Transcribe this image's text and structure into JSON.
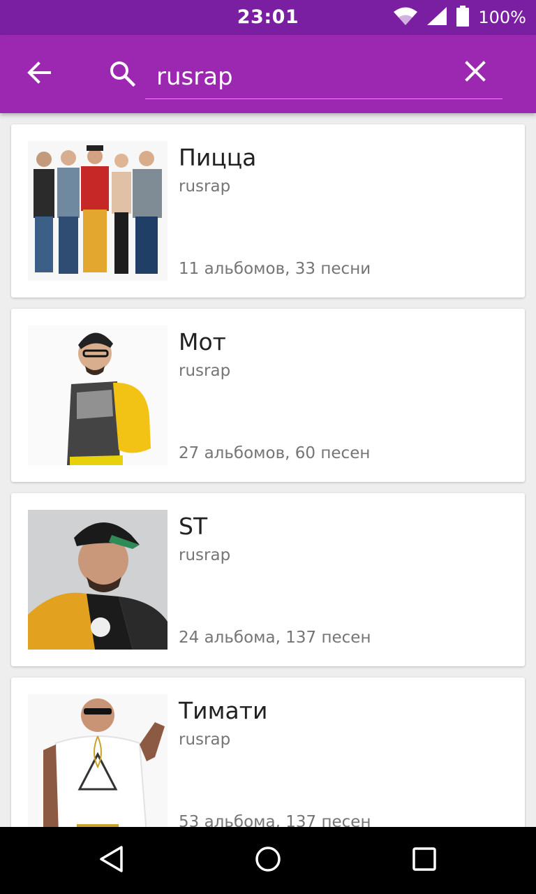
{
  "status_bar": {
    "time": "23:01",
    "battery_percent": "100%",
    "icons": [
      "wifi-icon",
      "signal-icon",
      "battery-icon"
    ]
  },
  "search": {
    "query": "rusrap",
    "icons": [
      "back-arrow-icon",
      "search-icon",
      "close-icon"
    ]
  },
  "colors": {
    "status_bar": "#7b1fa2",
    "app_bar": "#9c27b0",
    "background": "#eeeeee"
  },
  "results": [
    {
      "name": "Пицца",
      "genre": "rusrap",
      "counts": "11 альбомов, 33 песни"
    },
    {
      "name": "Мот",
      "genre": "rusrap",
      "counts": "27 альбомов, 60 песен"
    },
    {
      "name": "ST",
      "genre": "rusrap",
      "counts": "24 альбома, 137 песен"
    },
    {
      "name": "Тимати",
      "genre": "rusrap",
      "counts": "53 альбома, 137 песен"
    }
  ],
  "nav_bar": {
    "icons": [
      "back-triangle-icon",
      "home-circle-icon",
      "recents-square-icon"
    ]
  }
}
